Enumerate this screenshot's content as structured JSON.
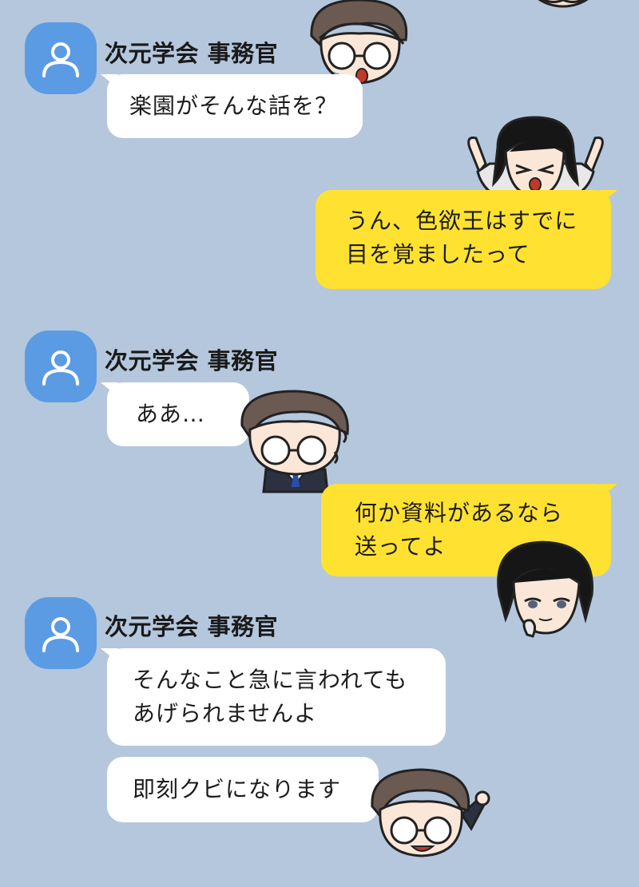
{
  "chat": {
    "background_color": "#b4c7dd",
    "sent_bubble_color": "#ffe231",
    "received_bubble_color": "#ffffff",
    "avatar_color": "#5b9be3",
    "messages": [
      {
        "sender": "次元学会 事務官",
        "text": "楽園がそんな話を？"
      },
      {
        "text": "うん、色欲王はすでに\n目を覚ましたって"
      },
      {
        "sender": "次元学会 事務官",
        "text": "ああ…"
      },
      {
        "text": "何か資料があるなら\n送ってよ"
      },
      {
        "sender": "次元学会 事務官",
        "text": "そんなこと急に言われても\nあげられませんよ"
      },
      {
        "text": "即刻クビになります"
      }
    ]
  }
}
